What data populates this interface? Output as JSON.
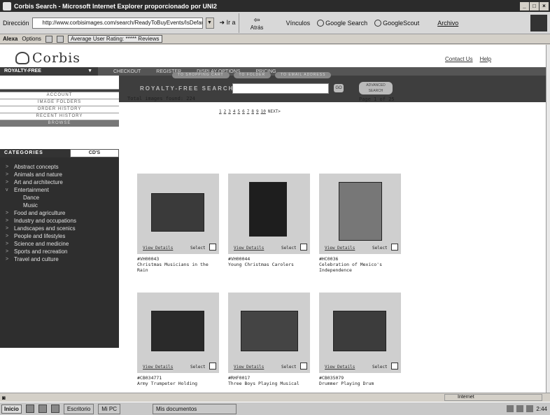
{
  "window": {
    "title": "Corbis Search - Microsoft Internet Explorer proporcionado por UNI2",
    "address_label": "Dirección",
    "url": "http://www.corbisimages.com/search/ReadyToBuyEvents/IsDefault.asp",
    "go_label": "Ir a",
    "back_label": "Atrás",
    "links_label": "Vínculos",
    "links": [
      "Google Search",
      "GoogleScout"
    ],
    "archivo_label": "Archivo"
  },
  "alexa_bar": {
    "brand": "Alexa",
    "options": "Options",
    "rating_label": "Average User Rating: ***** Reviews"
  },
  "site": {
    "logo_text": "Corbis",
    "top_links": [
      "Contact Us",
      "Help"
    ],
    "nav": {
      "royalty_free": "ROYALTY-FREE",
      "items": [
        "CHECKOUT",
        "REGISTER",
        "DISPLAY OPTIONS",
        "PRICING"
      ]
    },
    "search": {
      "label": "ROYALTY-FREE SEARCH",
      "go": "GO",
      "advanced": "ADVANCED SEARCH"
    },
    "cart_buttons": [
      "TO SHOPPING CART",
      "TO FOLDER",
      "TO EMAIL ADDRESS"
    ]
  },
  "sidebar": {
    "account_items": [
      "ACCOUNT",
      "IMAGE FOLDERS",
      "ORDER HISTORY",
      "RECENT HISTORY",
      "BROWSE"
    ],
    "tabs": [
      "CATEGORIES",
      "CD'S"
    ],
    "categories": [
      {
        "label": "Abstract concepts",
        "sub": false
      },
      {
        "label": "Animals and nature",
        "sub": false
      },
      {
        "label": "Art and architecture",
        "sub": false
      },
      {
        "label": "Entertainment",
        "sub": false
      },
      {
        "label": "Dance",
        "sub": true
      },
      {
        "label": "Music",
        "sub": true
      },
      {
        "label": "Food and agriculture",
        "sub": false
      },
      {
        "label": "Industry and occupations",
        "sub": false
      },
      {
        "label": "Landscapes and scenics",
        "sub": false
      },
      {
        "label": "People and lifestyles",
        "sub": false
      },
      {
        "label": "Science and medicine",
        "sub": false
      },
      {
        "label": "Sports and recreation",
        "sub": false
      },
      {
        "label": "Travel and culture",
        "sub": false
      }
    ]
  },
  "results": {
    "total": "Total images found: 224",
    "page_info": "Page 1 of 25",
    "pages": [
      "1",
      "2",
      "3",
      "4",
      "5",
      "6",
      "7",
      "8",
      "9",
      "10"
    ],
    "next": "NEXT>",
    "view_details": "View Details",
    "select": "Select",
    "images": [
      {
        "id": "#VH00043",
        "caption": "Christmas Musicians in the Rain"
      },
      {
        "id": "#VH00044",
        "caption": "Young Christmas Carolers"
      },
      {
        "id": "#HC0036",
        "caption": "Celebration of Mexico's Independence"
      },
      {
        "id": "#CB034771",
        "caption": "Army Trumpeter Holding"
      },
      {
        "id": "#RHF0017",
        "caption": "Three Boys Playing Musical"
      },
      {
        "id": "#CB035079",
        "caption": "Drummer Playing Drum"
      }
    ]
  },
  "status": {
    "zone": "Internet"
  },
  "taskbar": {
    "start": "Inicio",
    "tasks": [
      "Escritorio",
      "Mi PC",
      "Mis documentos"
    ],
    "clock": "2:44"
  }
}
